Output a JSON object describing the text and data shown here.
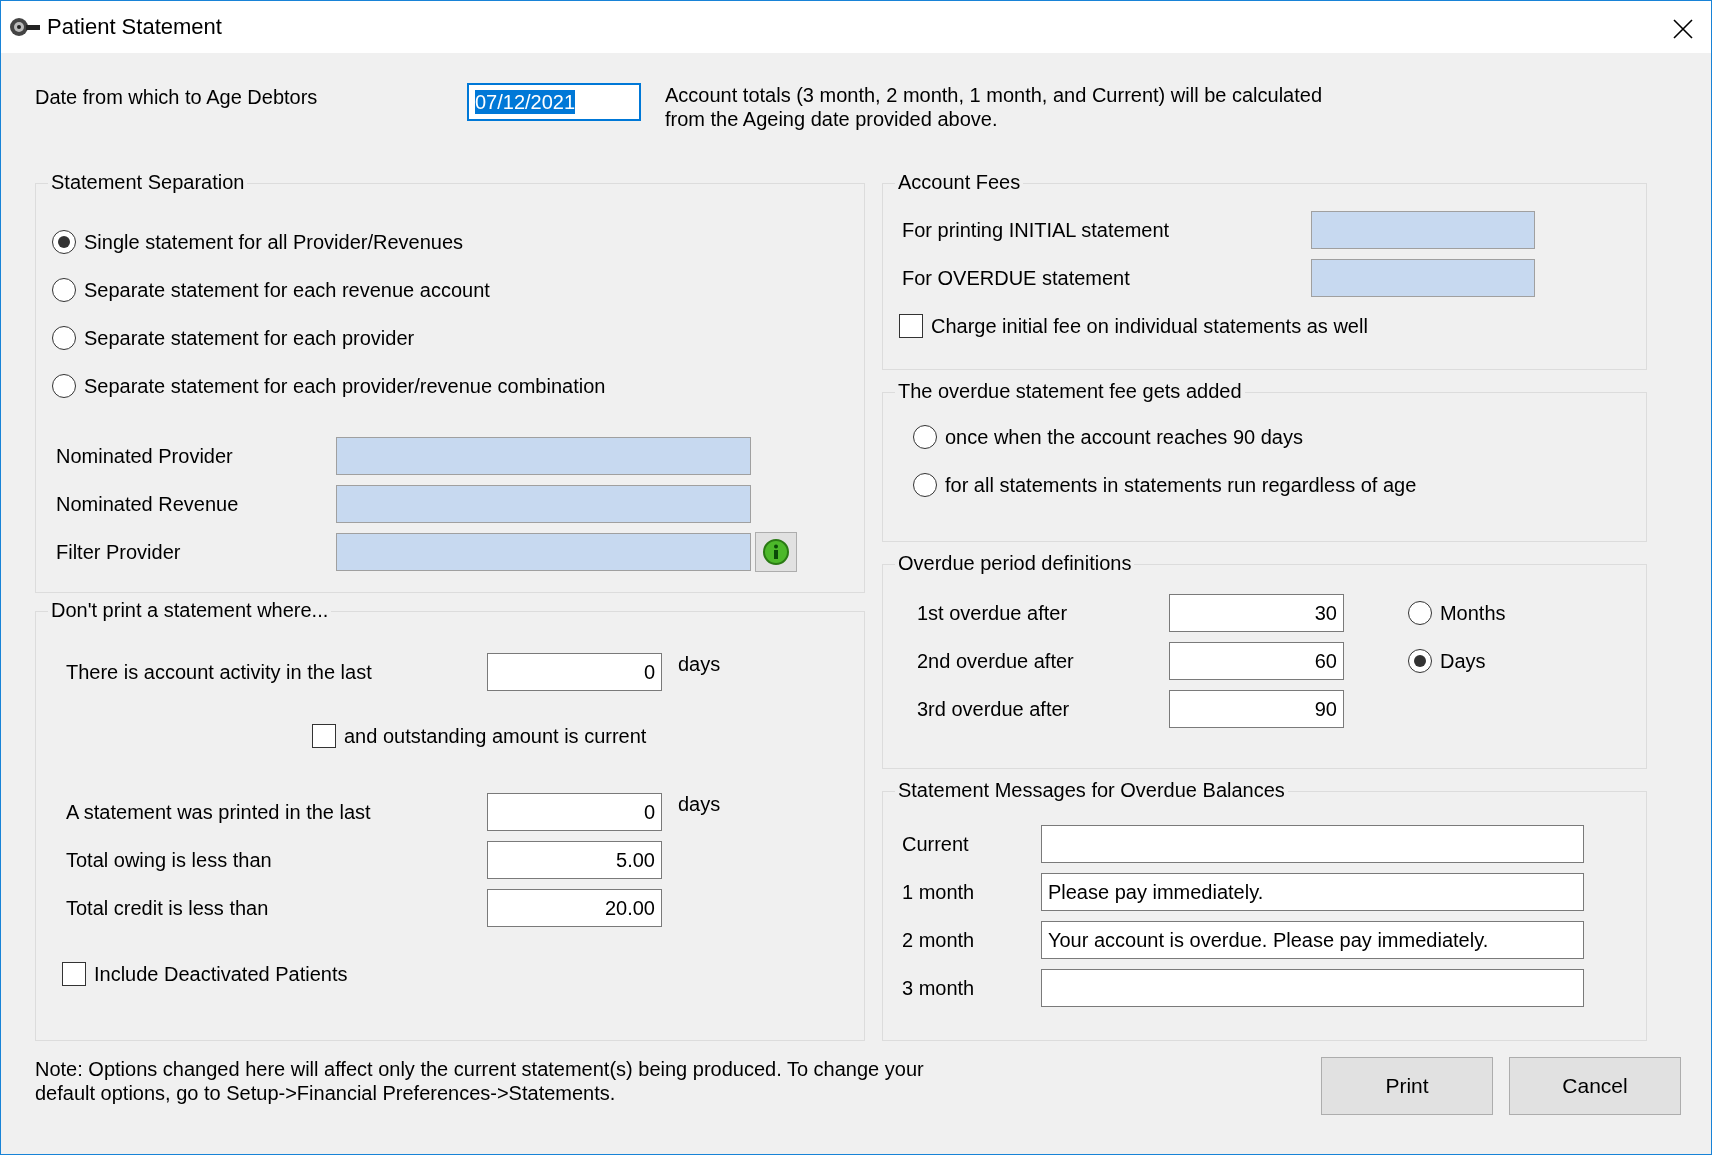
{
  "window": {
    "title": "Patient Statement"
  },
  "ageing": {
    "label": "Date from which to Age Debtors",
    "value": "07/12/2021",
    "selected": true,
    "note_lines": [
      "Account totals (3 month, 2 month, 1 month, and Current) will be calculated",
      "from the Ageing date provided above."
    ]
  },
  "statement_separation": {
    "title": "Statement Separation",
    "options": [
      {
        "label": "Single statement for all Provider/Revenues",
        "selected": true
      },
      {
        "label": "Separate statement for each revenue account",
        "selected": false
      },
      {
        "label": "Separate statement for each provider",
        "selected": false
      },
      {
        "label": "Separate statement for each provider/revenue combination",
        "selected": false
      }
    ],
    "fields": [
      {
        "label": "Nominated Provider",
        "kind": "text",
        "disabled": true
      },
      {
        "label": "Nominated Revenue",
        "kind": "text",
        "disabled": true
      },
      {
        "label": "Filter Provider",
        "kind": "lookup",
        "disabled": true
      }
    ]
  },
  "dont_print": {
    "title": "Don't print a statement where...",
    "rows": [
      {
        "kind": "field",
        "label": "There is account activity in the last",
        "value": "0",
        "unit": "days"
      },
      {
        "kind": "sub-check",
        "label": "and outstanding amount is current",
        "checked": false
      },
      {
        "kind": "field",
        "label": "A statement was printed in the last",
        "value": "0",
        "unit": "days"
      },
      {
        "kind": "field",
        "label": "Total owing is less than",
        "value": "5.00"
      },
      {
        "kind": "field",
        "label": "Total credit is less than",
        "value": "20.00"
      },
      {
        "kind": "check",
        "label": "Include Deactivated Patients",
        "checked": false
      }
    ]
  },
  "account_fees": {
    "title": "Account Fees",
    "fields": [
      {
        "label": "For printing INITIAL statement",
        "disabled": true
      },
      {
        "label": "For OVERDUE statement",
        "disabled": true
      }
    ],
    "checkbox": {
      "label": "Charge initial fee on individual statements as well",
      "checked": false
    }
  },
  "overdue_fee": {
    "title": "The overdue statement fee gets added",
    "options": [
      {
        "label": "once when the account reaches 90 days",
        "selected": false
      },
      {
        "label": "for all statements in statements run regardless of age",
        "selected": false
      }
    ]
  },
  "overdue_periods": {
    "title": "Overdue period definitions",
    "rows": [
      {
        "label": "1st overdue after",
        "value": "30"
      },
      {
        "label": "2nd overdue after",
        "value": "60"
      },
      {
        "label": "3rd overdue after",
        "value": "90"
      }
    ],
    "units": [
      {
        "label": "Months",
        "selected": false
      },
      {
        "label": "Days",
        "selected": true
      }
    ]
  },
  "messages": {
    "title": "Statement Messages for Overdue Balances",
    "rows": [
      {
        "label": "Current"
      },
      {
        "label": "1 month",
        "value": "Please pay immediately."
      },
      {
        "label": "2 month",
        "value": "Your account is overdue. Please pay immediately."
      },
      {
        "label": "3 month"
      }
    ]
  },
  "note_lines": [
    "Note: Options changed here will affect only the current statement(s) being produced. To change your",
    "default options, go to Setup->Financial Preferences->Statements."
  ],
  "buttons": [
    {
      "label": "Print"
    },
    {
      "label": "Cancel"
    }
  ]
}
